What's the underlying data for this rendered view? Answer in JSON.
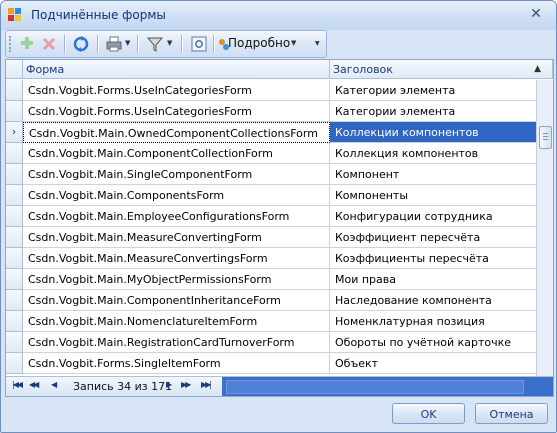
{
  "window": {
    "title": "Подчинённые формы",
    "close_glyph": "✕"
  },
  "toolbar": {
    "details_label": "Подробно"
  },
  "grid": {
    "columns": [
      "Форма",
      "Заголовок"
    ],
    "sort_indicator": "▲",
    "current_row_marker": "›",
    "rows": [
      {
        "form": "Csdn.Vogbit.Forms.UseInCategoriesForm",
        "title": "Категории элемента"
      },
      {
        "form": "Csdn.Vogbit.Forms.UseInCategoriesForm",
        "title": "Категории элемента"
      },
      {
        "form": "Csdn.Vogbit.Main.OwnedComponentCollectionsForm",
        "title": "Коллекции компонентов"
      },
      {
        "form": "Csdn.Vogbit.Main.ComponentCollectionForm",
        "title": "Коллекция компонентов"
      },
      {
        "form": "Csdn.Vogbit.Main.SingleComponentForm",
        "title": "Компонент"
      },
      {
        "form": "Csdn.Vogbit.Main.ComponentsForm",
        "title": "Компоненты"
      },
      {
        "form": "Csdn.Vogbit.Main.EmployeeConfigurationsForm",
        "title": "Конфигурации сотрудника"
      },
      {
        "form": "Csdn.Vogbit.Main.MeasureConvertingForm",
        "title": "Коэффициент пересчёта"
      },
      {
        "form": "Csdn.Vogbit.Main.MeasureConvertingsForm",
        "title": "Коэффициенты пересчёта"
      },
      {
        "form": "Csdn.Vogbit.Main.MyObjectPermissionsForm",
        "title": "Мои права"
      },
      {
        "form": "Csdn.Vogbit.Main.ComponentInheritanceForm",
        "title": "Наследование компонента"
      },
      {
        "form": "Csdn.Vogbit.Main.NomenclatureItemForm",
        "title": "Номенклатурная позиция"
      },
      {
        "form": "Csdn.Vogbit.Main.RegistrationCardTurnoverForm",
        "title": "Обороты по учётной карточке"
      },
      {
        "form": "Csdn.Vogbit.Forms.SingleItemForm",
        "title": "Объект"
      }
    ],
    "selected_index": 2,
    "record_info": "Запись 34 из 171"
  },
  "buttons": {
    "ok": "OK",
    "cancel": "Отмена"
  },
  "colors": {
    "selection": "#3166c2",
    "title_text": "#14307a"
  }
}
